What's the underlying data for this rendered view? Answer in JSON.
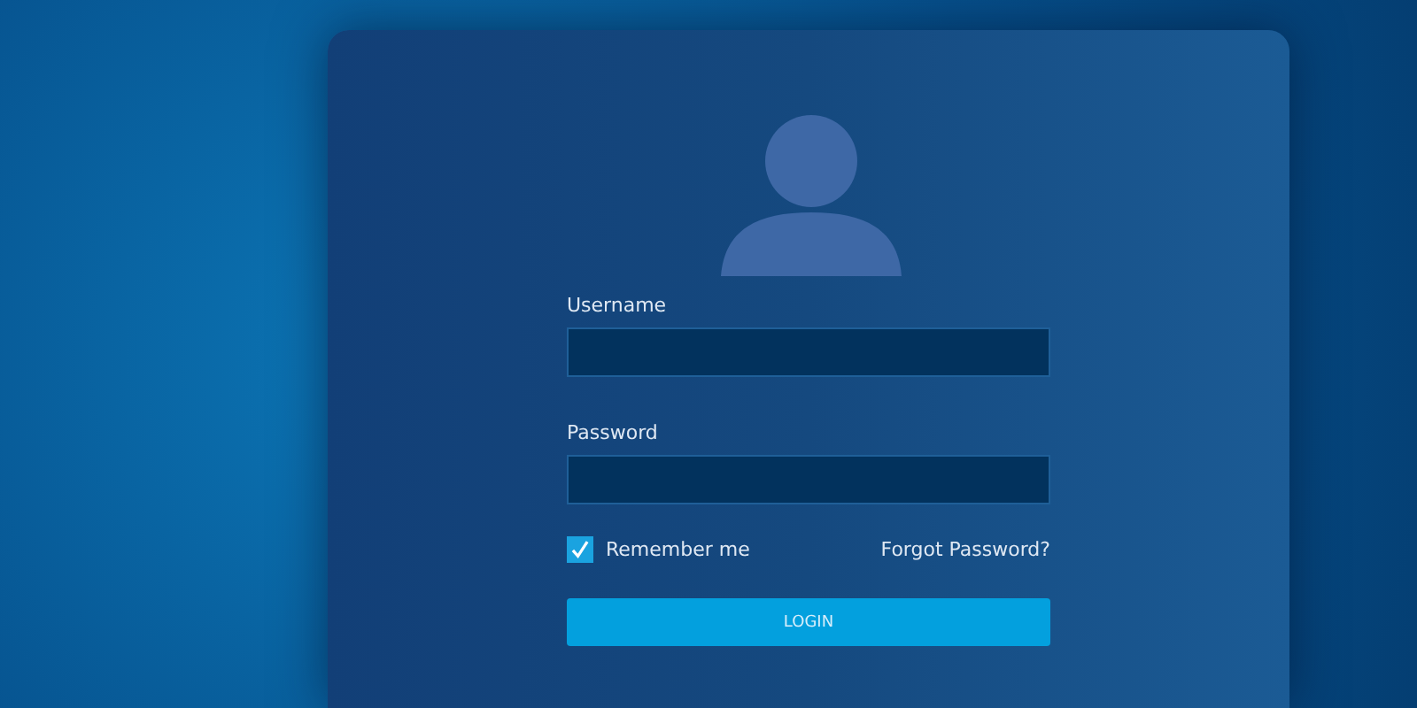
{
  "login_form": {
    "fields": [
      {
        "label": "Username"
      },
      {
        "label": "Password"
      }
    ],
    "remember_me": {
      "label": "Remember me",
      "checked": true
    },
    "forgot_link": "Forgot Password?",
    "submit_button": "LOGIN"
  }
}
